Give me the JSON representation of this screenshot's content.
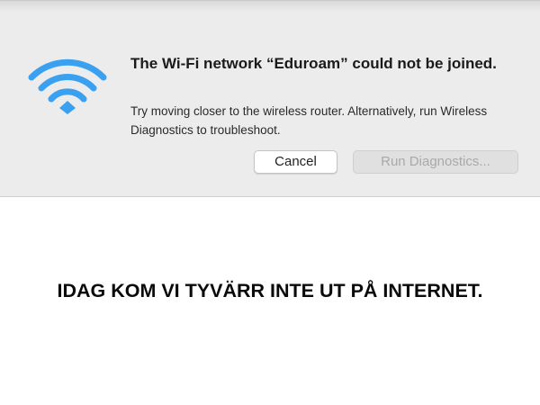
{
  "dialog": {
    "icon": "wifi-icon",
    "title": "The Wi-Fi network “Eduroam” could not be joined.",
    "message": "Try moving closer to the wireless router. Alternatively, run Wireless Diagnostics to troubleshoot.",
    "cancel_label": "Cancel",
    "run_diagnostics_label": "Run Diagnostics...",
    "accent_color": "#3aa0f0"
  },
  "caption": {
    "text": "IDAG KOM VI TYVÄRR INTE UT PÅ INTERNET."
  }
}
